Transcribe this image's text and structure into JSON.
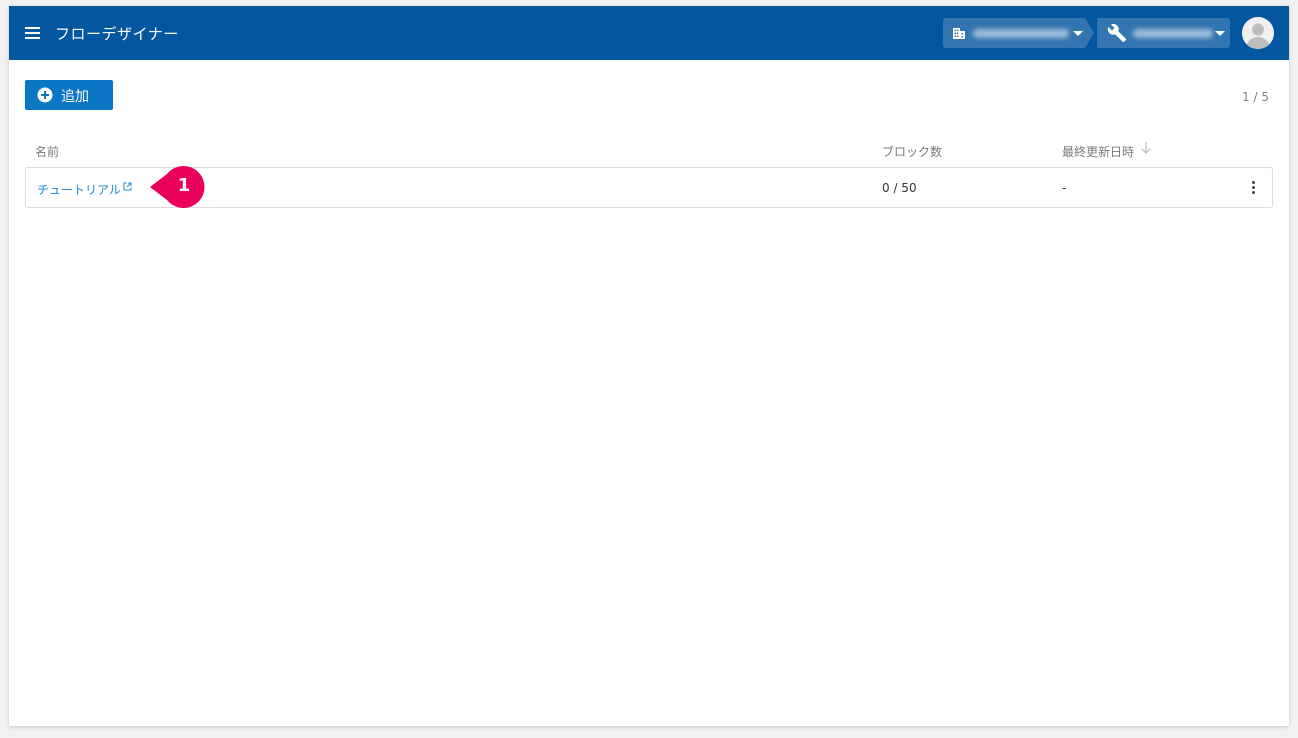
{
  "header": {
    "app_title": "フローデザイナー",
    "menu_icon": "hamburger-menu-icon",
    "org_selector": {
      "icon": "building-icon",
      "value_redacted": "████████████"
    },
    "tool_selector": {
      "icon": "wrench-icon",
      "value_redacted": "████████████"
    },
    "avatar_icon": "user-avatar-icon",
    "bar_color": "#0357a0"
  },
  "toolbar": {
    "add_label": "追加",
    "add_icon": "plus-circle-icon",
    "pagination": "1 / 5",
    "button_color": "#0b76c3"
  },
  "table": {
    "columns": [
      {
        "label": "名前"
      },
      {
        "label": "ブロック数"
      },
      {
        "label": "最終更新日時",
        "sort_icon": "arrow-down-icon"
      }
    ],
    "rows": [
      {
        "name": "チュートリアル",
        "name_icon": "external-link-icon",
        "blocks": "0 / 50",
        "updated": "-",
        "menu_icon": "more-vertical-icon"
      }
    ]
  },
  "annotation": {
    "number": "1",
    "color": "#e8005b"
  }
}
